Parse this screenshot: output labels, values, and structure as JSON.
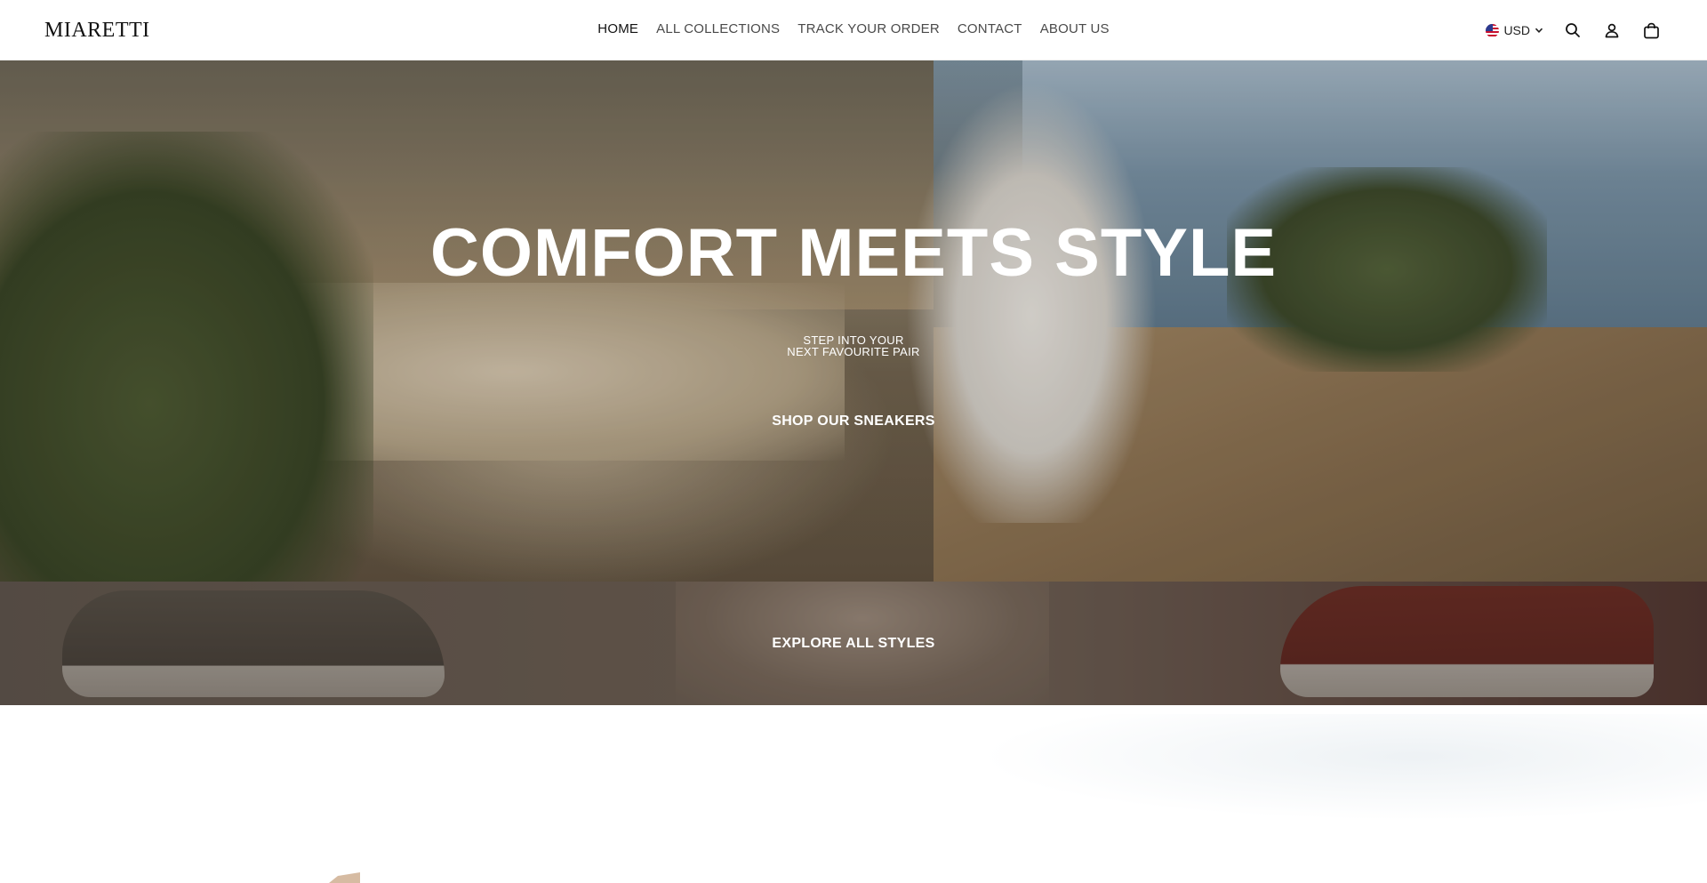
{
  "brand": {
    "logo_text": "MIARETTI"
  },
  "nav": {
    "items": [
      {
        "label": "HOME",
        "active": true
      },
      {
        "label": "ALL COLLECTIONS",
        "active": false
      },
      {
        "label": "TRACK YOUR ORDER",
        "active": false
      },
      {
        "label": "CONTACT",
        "active": false
      },
      {
        "label": "ABOUT US",
        "active": false
      }
    ]
  },
  "header": {
    "currency": "USD",
    "icons": [
      "flag-us-icon",
      "chevron-down-icon",
      "search-icon",
      "account-icon",
      "cart-icon"
    ]
  },
  "hero": {
    "title": "COMFORT MEETS STYLE",
    "subtitle_line1": "STEP INTO YOUR",
    "subtitle_line2": "NEXT FAVOURITE PAIR",
    "cta": "SHOP OUR SNEAKERS"
  },
  "banner2": {
    "cta": "EXPLORE ALL STYLES"
  },
  "colors": {
    "text_dark": "#121212",
    "nav_text": "#4a4a4a",
    "hero_text": "#ffffff"
  }
}
